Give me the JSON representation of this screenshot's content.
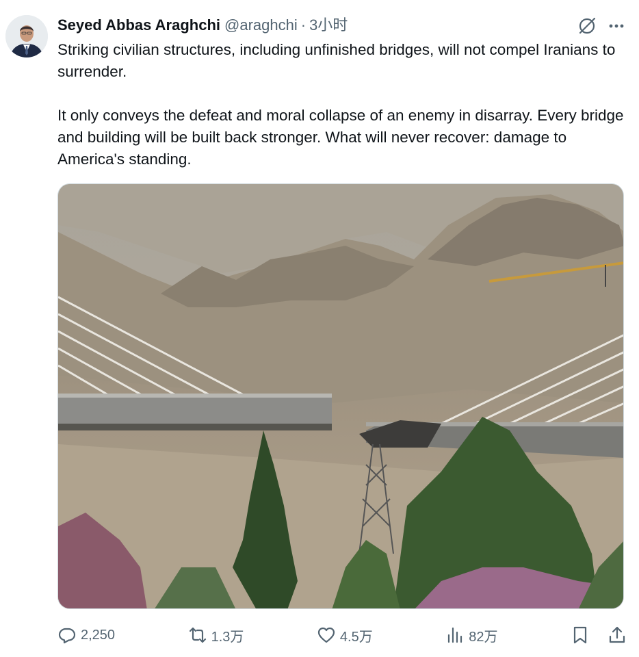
{
  "author": {
    "name": "Seyed Abbas Araghchi",
    "handle": "@araghchi",
    "separator": "·",
    "time": "3小时"
  },
  "tweet": {
    "paragraphs": [
      "Striking civilian structures, including unfinished bridges, will not compel Iranians to surrender.",
      "It only conveys the defeat and moral collapse of an enemy in disarray. Every bridge and building will be built back stronger. What will never recover: damage to America's standing."
    ]
  },
  "actions": {
    "replies": "2,250",
    "reposts": "1.3万",
    "likes": "4.5万",
    "views": "82万"
  },
  "icons": {
    "grok": "grok-icon",
    "more": "more-icon",
    "reply": "reply-icon",
    "repost": "repost-icon",
    "like": "heart-icon",
    "views": "analytics-icon",
    "bookmark": "bookmark-icon",
    "share": "share-icon"
  },
  "colors": {
    "text": "#0f1419",
    "secondary": "#536471",
    "border": "#cfd9de"
  }
}
